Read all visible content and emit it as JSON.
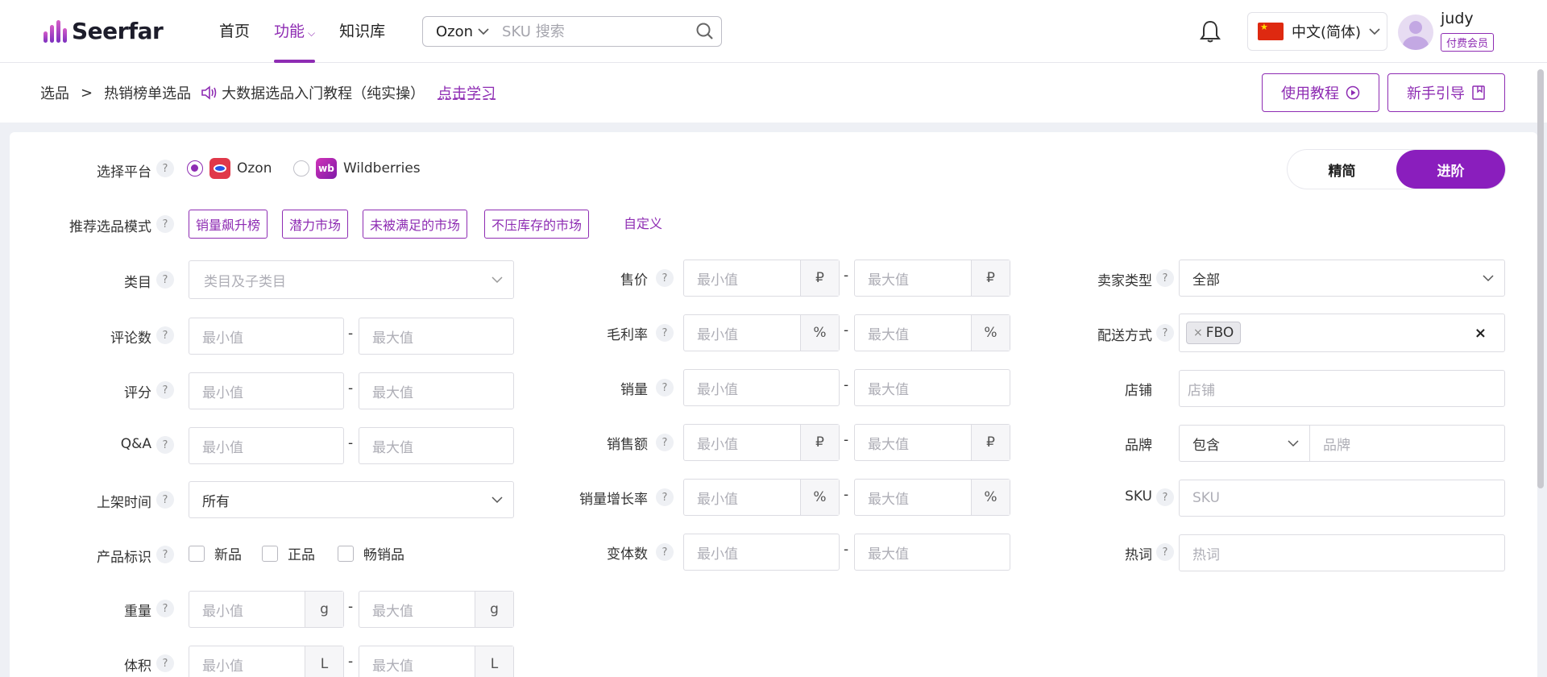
{
  "header": {
    "logo_text": "Seerfar",
    "nav": [
      {
        "label": "首页",
        "active": false
      },
      {
        "label": "功能",
        "active": true,
        "dropdown": true
      },
      {
        "label": "知识库",
        "active": false
      }
    ],
    "search": {
      "platform": "Ozon",
      "placeholder": "SKU 搜索"
    },
    "language": "中文(简体)",
    "username": "judy",
    "member_badge": "付费会员"
  },
  "breadcrumb": {
    "root": "选品",
    "separator": ">",
    "current": "热销榜单选品",
    "tutorial_text": "大数据选品入门教程（纯实操）",
    "learn_link": "点击学习"
  },
  "actions": {
    "tutorial_button": "使用教程",
    "guide_button": "新手引导"
  },
  "platform": {
    "label": "选择平台",
    "options": [
      {
        "label": "Ozon",
        "selected": true
      },
      {
        "label": "Wildberries",
        "selected": false
      }
    ]
  },
  "mode_toggle": {
    "simple": "精简",
    "advanced": "进阶",
    "active": "进阶"
  },
  "recommend": {
    "label": "推荐选品模式",
    "tags": [
      "销量飙升榜",
      "潜力市场",
      "未被满足的市场",
      "不压库存的市场"
    ],
    "custom": "自定义"
  },
  "filters": {
    "min_placeholder": "最小值",
    "max_placeholder": "最大值",
    "range_dash": "-",
    "category": {
      "label": "类目",
      "placeholder": "类目及子类目"
    },
    "reviews": {
      "label": "评论数"
    },
    "rating": {
      "label": "评分"
    },
    "qa": {
      "label": "Q&A"
    },
    "listed_time": {
      "label": "上架时间",
      "value": "所有"
    },
    "product_flags": {
      "label": "产品标识",
      "options": [
        "新品",
        "正品",
        "畅销品"
      ]
    },
    "weight": {
      "label": "重量",
      "unit": "g"
    },
    "volume": {
      "label": "体积",
      "unit": "L"
    },
    "price": {
      "label": "售价",
      "unit": "₽"
    },
    "gross_margin": {
      "label": "毛利率",
      "unit": "%"
    },
    "sales": {
      "label": "销量"
    },
    "revenue": {
      "label": "销售额",
      "unit": "₽"
    },
    "sales_growth": {
      "label": "销量增长率",
      "unit": "%"
    },
    "variants": {
      "label": "变体数"
    },
    "seller_type": {
      "label": "卖家类型",
      "value": "全部"
    },
    "delivery": {
      "label": "配送方式",
      "chip": "FBO",
      "chip_remove": "×",
      "clear": "×"
    },
    "store": {
      "label": "店铺",
      "placeholder": "店铺"
    },
    "brand": {
      "label": "品牌",
      "mode": "包含",
      "placeholder": "品牌"
    },
    "sku": {
      "label": "SKU",
      "placeholder": "SKU"
    },
    "keyword": {
      "label": "热词",
      "placeholder": "热词"
    }
  },
  "help_symbol": "?",
  "colors": {
    "accent": "#8e2cb3",
    "toggle_active": "#8a1ebd"
  }
}
